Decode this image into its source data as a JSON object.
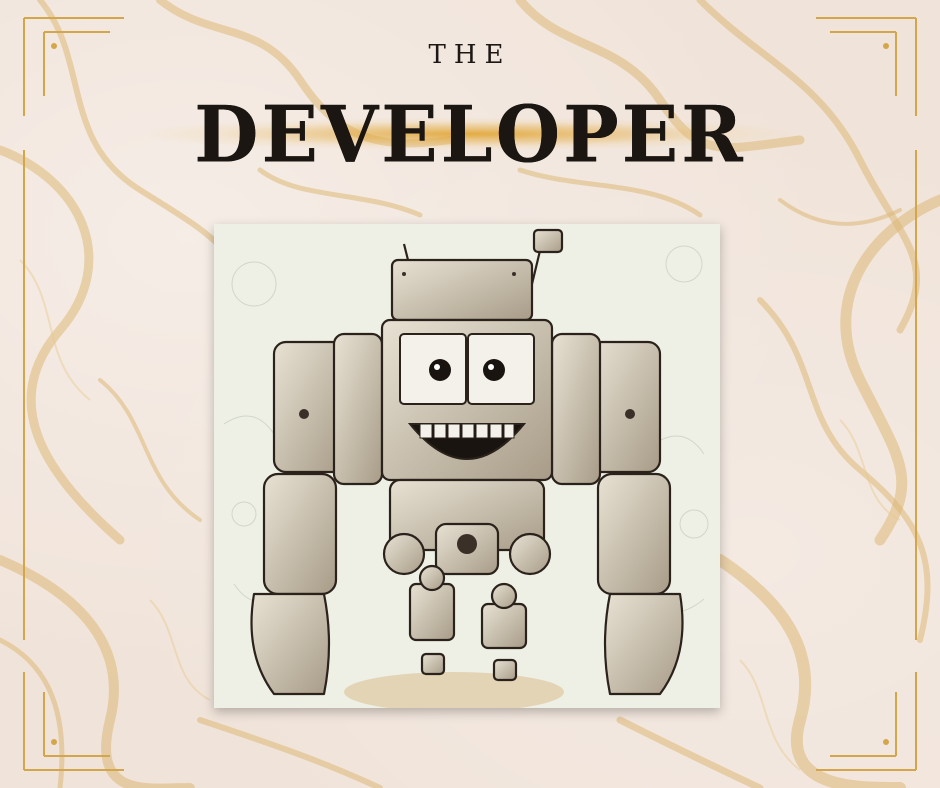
{
  "poster": {
    "subtitle": "THE",
    "title": "DEVELOPER",
    "accent_color": "#d4a64a",
    "background_color": "#f0e3d9",
    "ink_color": "#1b1612"
  },
  "illustration": {
    "subject": "robot-icon",
    "background_color": "#eef0e6"
  }
}
